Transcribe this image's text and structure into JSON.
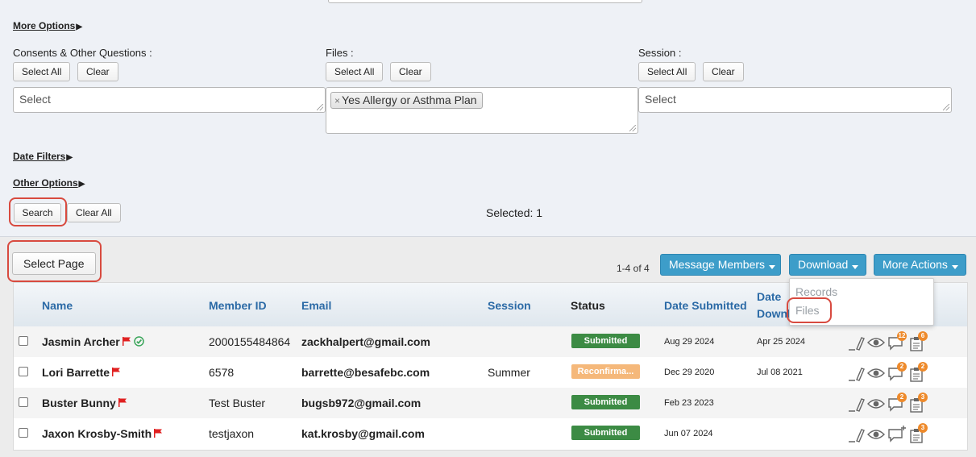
{
  "filters": {
    "more_options": "More Options",
    "consents_label": "Consents & Other Questions :",
    "files_label": "Files :",
    "session_label": "Session :",
    "select_all": "Select All",
    "clear": "Clear",
    "select_placeholder": "Select",
    "files_chip": "Yes Allergy or Asthma Plan",
    "date_filters": "Date Filters",
    "other_options": "Other Options",
    "search": "Search",
    "clear_all": "Clear All",
    "selected_text": "Selected: 1"
  },
  "toolbar": {
    "select_page": "Select Page",
    "pagination": "1-4 of 4",
    "message_members": "Message Members",
    "download": "Download",
    "more_actions": "More Actions"
  },
  "download_menu": {
    "records": "Records",
    "files": "Files"
  },
  "table": {
    "headers": {
      "name": "Name",
      "member_id": "Member ID",
      "email": "Email",
      "session": "Session",
      "status": "Status",
      "date_submitted": "Date Submitted",
      "date_downloaded_line1": "Date",
      "date_downloaded_line2": "Downl"
    },
    "rows": [
      {
        "name": "Jasmin Archer",
        "member_id": "2000155484864",
        "email": "zackhalpert@gmail.com",
        "session": "",
        "status": "Submitted",
        "date_submitted": "Aug 29 2024",
        "date_downloaded": "Apr 25 2024",
        "comments": "12",
        "docs": "6"
      },
      {
        "name": "Lori Barrette",
        "member_id": "6578",
        "email": "barrette@besafebc.com",
        "session": "Summer",
        "status": "Reconfirma...",
        "date_submitted": "Dec 29 2020",
        "date_downloaded": "Jul 08 2021",
        "comments": "2",
        "docs": "2"
      },
      {
        "name": "Buster Bunny",
        "member_id": "Test Buster",
        "email": "bugsb972@gmail.com",
        "session": "",
        "status": "Submitted",
        "date_submitted": "Feb 23 2023",
        "date_downloaded": "",
        "comments": "2",
        "docs": "3"
      },
      {
        "name": "Jaxon Krosby-Smith",
        "member_id": "testjaxon",
        "email": "kat.krosby@gmail.com",
        "session": "",
        "status": "Submitted",
        "date_submitted": "Jun 07 2024",
        "date_downloaded": "",
        "comments": "",
        "docs": "3"
      }
    ]
  },
  "colors": {
    "accent_blue": "#3d9dc9",
    "submitted_green": "#3c8b44",
    "reconfirm_orange": "#f5b87a",
    "flag_red": "#e02020",
    "highlight_ring": "#d84a3f"
  }
}
